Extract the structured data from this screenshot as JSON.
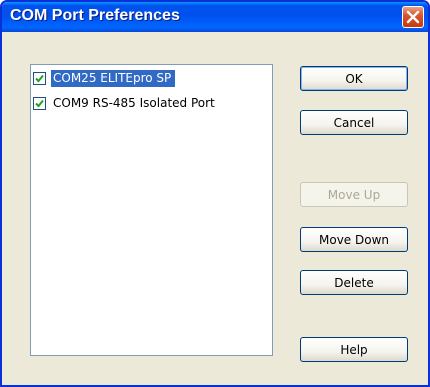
{
  "window": {
    "title": "COM Port Preferences",
    "close_icon": "close-icon"
  },
  "ports": [
    {
      "label": "COM25 ELITEpro SP",
      "checked": true,
      "selected": true
    },
    {
      "label": "COM9 RS-485 Isolated Port",
      "checked": true,
      "selected": false
    }
  ],
  "buttons": {
    "ok": "OK",
    "cancel": "Cancel",
    "move_up": "Move Up",
    "move_down": "Move Down",
    "delete": "Delete",
    "help": "Help"
  },
  "colors": {
    "titlebar": "#0054e3",
    "selection": "#316ac5",
    "dialog_bg": "#ece9d8",
    "close_button": "#d9572c",
    "checkmark": "#21a121"
  }
}
